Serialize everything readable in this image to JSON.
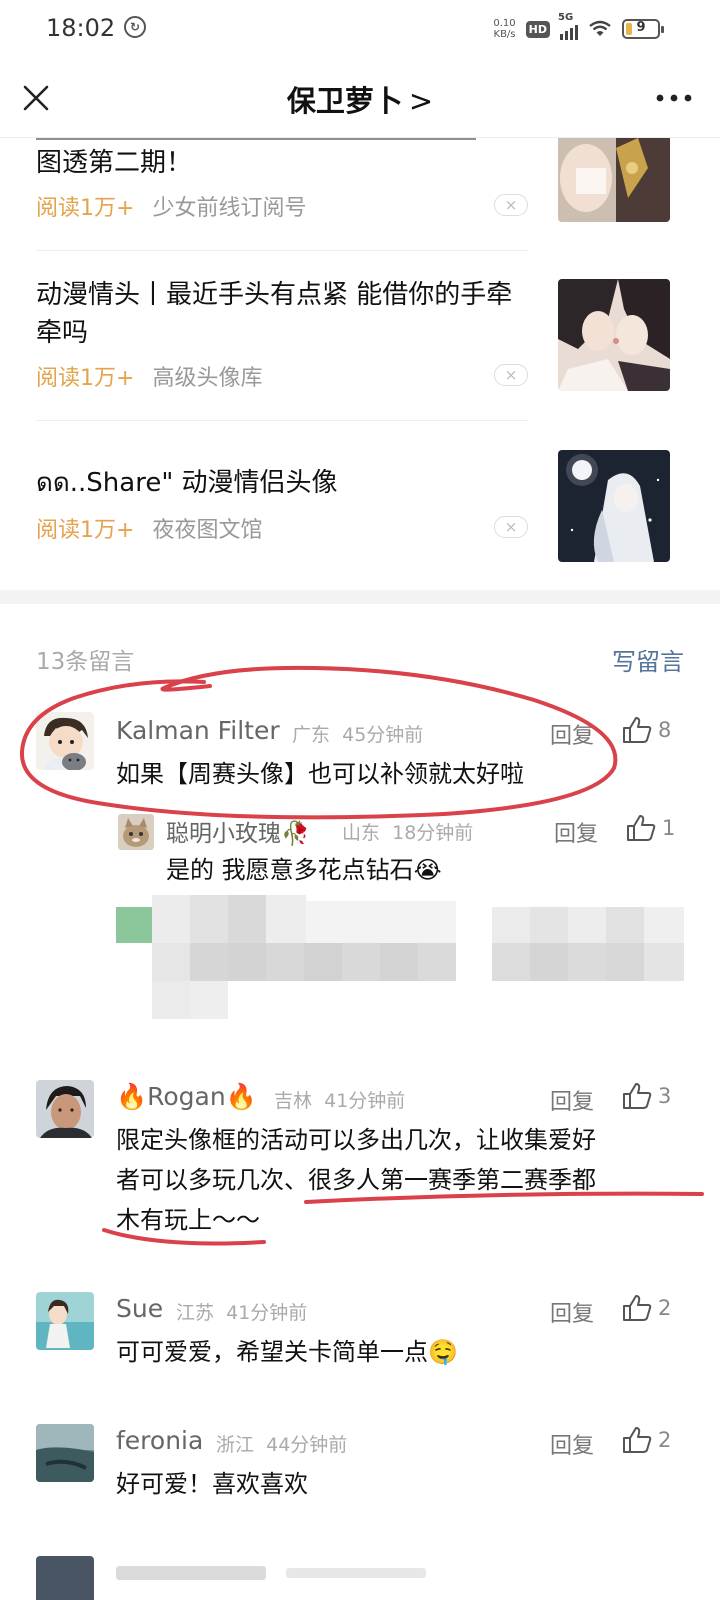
{
  "status_bar": {
    "time": "18:02",
    "sync_icon": "sync-icon",
    "net_speed_value": "0.10",
    "net_speed_unit": "KB/s",
    "hd_label": "HD",
    "network_label": "5G",
    "battery_level": "9",
    "battery_fraction": 0.2
  },
  "nav": {
    "title": "保卫萝卜",
    "chevron": ">",
    "close_icon": "close-icon",
    "more_icon": "more-dots-icon"
  },
  "articles": [
    {
      "title": "图透第二期！",
      "reads": "阅读1万+",
      "source": "少女前线订阅号",
      "dismiss": "×"
    },
    {
      "title": "动漫情头丨最近手头有点紧 能借你的手牵牵吗",
      "reads": "阅读1万+",
      "source": "高级头像库",
      "dismiss": "×"
    },
    {
      "title": "ดด..Share\" 动漫情侣头像",
      "reads": "阅读1万+",
      "source": "夜夜图文馆",
      "dismiss": "×"
    }
  ],
  "comments_section": {
    "count_label": "13条留言",
    "write_label": "写留言"
  },
  "comments": [
    {
      "name": "Kalman Filter",
      "location": "广东",
      "time": "45分钟前",
      "reply_label": "回复",
      "likes": "8",
      "text": "如果【周赛头像】也可以补领就太好啦",
      "highlight": "circled",
      "replies": [
        {
          "name": "聪明小玫瑰🥀",
          "location": "山东",
          "time": "18分钟前",
          "reply_label": "回复",
          "likes": "1",
          "text": "是的 我愿意多花点钻石😭"
        }
      ]
    },
    {
      "name": "🔥Rogan🔥",
      "location": "吉林",
      "time": "41分钟前",
      "reply_label": "回复",
      "likes": "3",
      "text_lines": [
        "限定头像框的活动可以多出几次，让收集爱好",
        "者可以多玩几次、很多人第一赛季第二赛季都",
        "木有玩上～～"
      ],
      "highlight": "underlined"
    },
    {
      "name": "Sue",
      "location": "江苏",
      "time": "41分钟前",
      "reply_label": "回复",
      "likes": "2",
      "text": "可可爱爱，希望关卡简单一点🤤"
    },
    {
      "name": "feronia",
      "location": "浙江",
      "time": "44分钟前",
      "reply_label": "回复",
      "likes": "2",
      "text": "好可爱！喜欢喜欢"
    }
  ],
  "colors": {
    "reads_orange": "#e3a44c",
    "link_blue": "#56739c",
    "annotation_red": "#d9414b"
  },
  "icons": {
    "like": "thumbs-up-icon",
    "dismiss": "dismiss-icon"
  }
}
